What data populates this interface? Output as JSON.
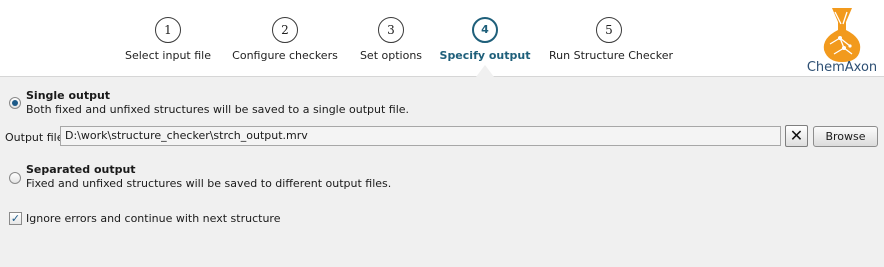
{
  "wizard": {
    "steps": [
      {
        "number": "1",
        "label": "Select input file"
      },
      {
        "number": "2",
        "label": "Configure checkers"
      },
      {
        "number": "3",
        "label": "Set options"
      },
      {
        "number": "4",
        "label": "Specify output",
        "active": true
      },
      {
        "number": "5",
        "label": "Run Structure Checker"
      }
    ],
    "active_color": "#1e5f7a"
  },
  "logo": {
    "text": "ChemAxon",
    "icon": "chemaxon-flask-logo",
    "color": "#f29a1d"
  },
  "single_output": {
    "title": "Single output",
    "description": "Both fixed and unfixed structures will be saved to a single output file.",
    "selected": true
  },
  "output_file": {
    "label": "Output file",
    "value": "D:\\work\\structure_checker\\strch_output.mrv",
    "clear_icon": "close-icon",
    "browse_label": "Browse"
  },
  "separated_output": {
    "title": "Separated output",
    "description": "Fixed and unfixed structures will be saved to different output files.",
    "selected": false
  },
  "ignore_errors": {
    "label": "Ignore errors and continue with next structure",
    "checked": true
  }
}
